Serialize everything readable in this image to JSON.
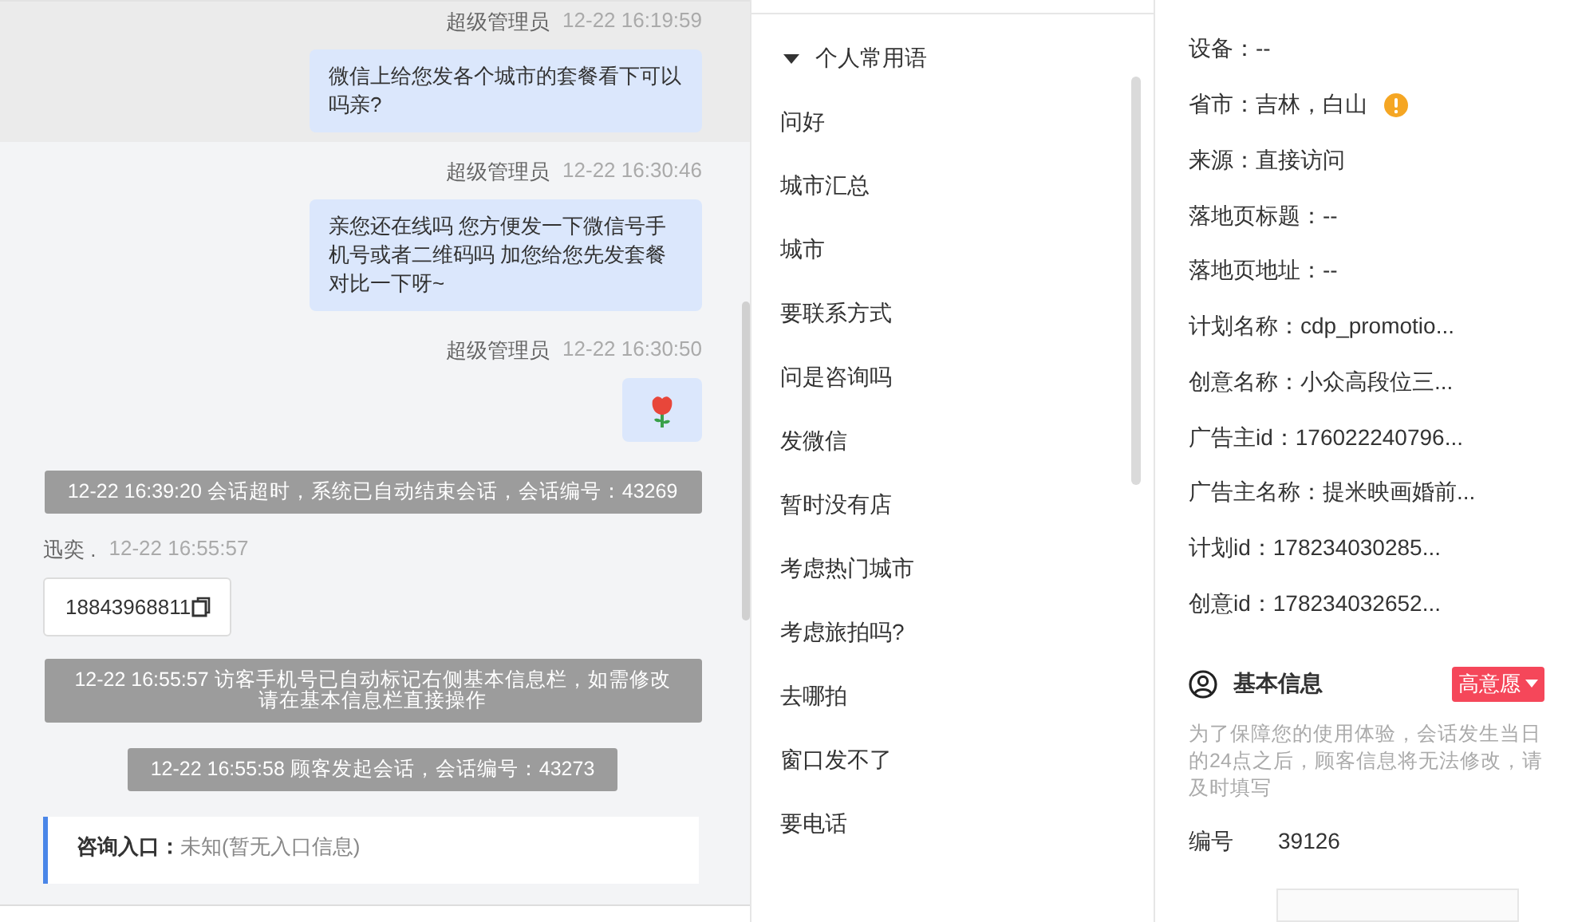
{
  "chat": {
    "messages": [
      {
        "kind": "agent",
        "sender": "超级管理员",
        "time": "12-22 16:19:59",
        "text": "微信上给您发各个城市的套餐看下可以吗亲?",
        "highlighted": true
      },
      {
        "kind": "agent",
        "sender": "超级管理员",
        "time": "12-22 16:30:46",
        "text": "亲您还在线吗 您方便发一下微信号手机号或者二维码吗 加您给您先发套餐对比一下呀~",
        "highlighted": false
      },
      {
        "kind": "sticker",
        "sender": "超级管理员",
        "time": "12-22 16:30:50",
        "highlighted": false
      },
      {
        "kind": "system",
        "text": "12-22 16:39:20 会话超时，系统已自动结束会话，会话编号：43269",
        "wide": true
      },
      {
        "kind": "visitor",
        "sender": "迅奕 .",
        "time": "12-22 16:55:57",
        "card": "18843968811"
      },
      {
        "kind": "system",
        "text": "12-22 16:55:57 访客手机号已自动标记右侧基本信息栏，如需修改请在基本信息栏直接操作",
        "wide": true
      },
      {
        "kind": "system",
        "text": "12-22 16:55:58 顾客发起会话，会话编号：43273",
        "wide": false
      },
      {
        "kind": "entry",
        "label": "咨询入口：",
        "value": "未知(暂无入口信息)"
      }
    ]
  },
  "phrases": {
    "title": "个人常用语",
    "expanded": true,
    "items": [
      "问好",
      "城市汇总",
      "城市",
      "要联系方式",
      "问是咨询吗",
      "发微信",
      "暂时没有店",
      "考虑热门城市",
      "考虑旅拍吗?",
      "去哪拍",
      "窗口发不了",
      "要电话"
    ]
  },
  "source_info": {
    "fields": [
      {
        "text": "设备：--",
        "warning": false
      },
      {
        "text": "省市：吉林，白山",
        "warning": true
      },
      {
        "text": "来源：直接访问",
        "warning": false
      },
      {
        "text": "落地页标题：--",
        "warning": false
      },
      {
        "text": "落地页地址：--",
        "warning": false
      },
      {
        "text": "计划名称：cdp_promotio...",
        "warning": false
      },
      {
        "text": "创意名称：小众高段位三...",
        "warning": false
      },
      {
        "text": "广告主id：176022240796...",
        "warning": false
      },
      {
        "text": "广告主名称：提米映画婚前...",
        "warning": false
      },
      {
        "text": "计划id：178234030285...",
        "warning": false
      },
      {
        "text": "创意id：178234032652...",
        "warning": false
      }
    ]
  },
  "basic_info": {
    "title": "基本信息",
    "intent": "高意愿",
    "note": "为了保障您的使用体验，会话发生当日的24点之后，顾客信息将无法修改，请及时填写",
    "id_label": "编号",
    "id_value": "39126"
  }
}
